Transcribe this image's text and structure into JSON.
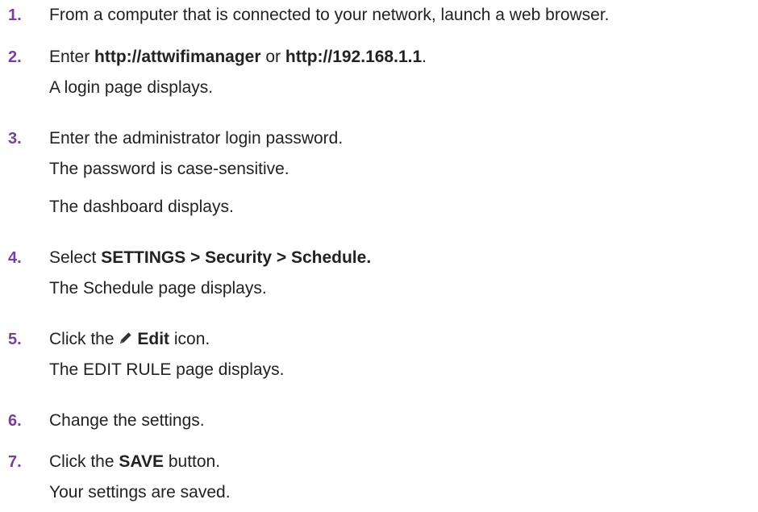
{
  "colors": {
    "step_number": "#7a3e9d",
    "text": "#222222"
  },
  "steps": [
    {
      "number": "1.",
      "parts": [
        "From a computer that is connected to your network, launch a web browser."
      ]
    },
    {
      "number": "2.",
      "parts": [
        "Enter ",
        "http://attwifimanager",
        " or ",
        "http://192.168.1.1",
        "."
      ],
      "result": "A login page displays."
    },
    {
      "number": "3.",
      "parts": [
        "Enter the administrator login password."
      ],
      "note": "The password is case-sensitive.",
      "result": "The dashboard displays."
    },
    {
      "number": "4.",
      "parts": [
        "Select ",
        "SETTINGS > Security > Schedule."
      ],
      "result": "The Schedule page displays."
    },
    {
      "number": "5.",
      "parts": [
        "Click the ",
        "Edit",
        " icon."
      ],
      "icon": "pencil-icon",
      "result": "The EDIT RULE page displays."
    },
    {
      "number": "6.",
      "parts": [
        "Change the settings."
      ]
    },
    {
      "number": "7.",
      "parts": [
        "Click the ",
        "SAVE",
        " button."
      ],
      "result": "Your settings are saved."
    }
  ]
}
